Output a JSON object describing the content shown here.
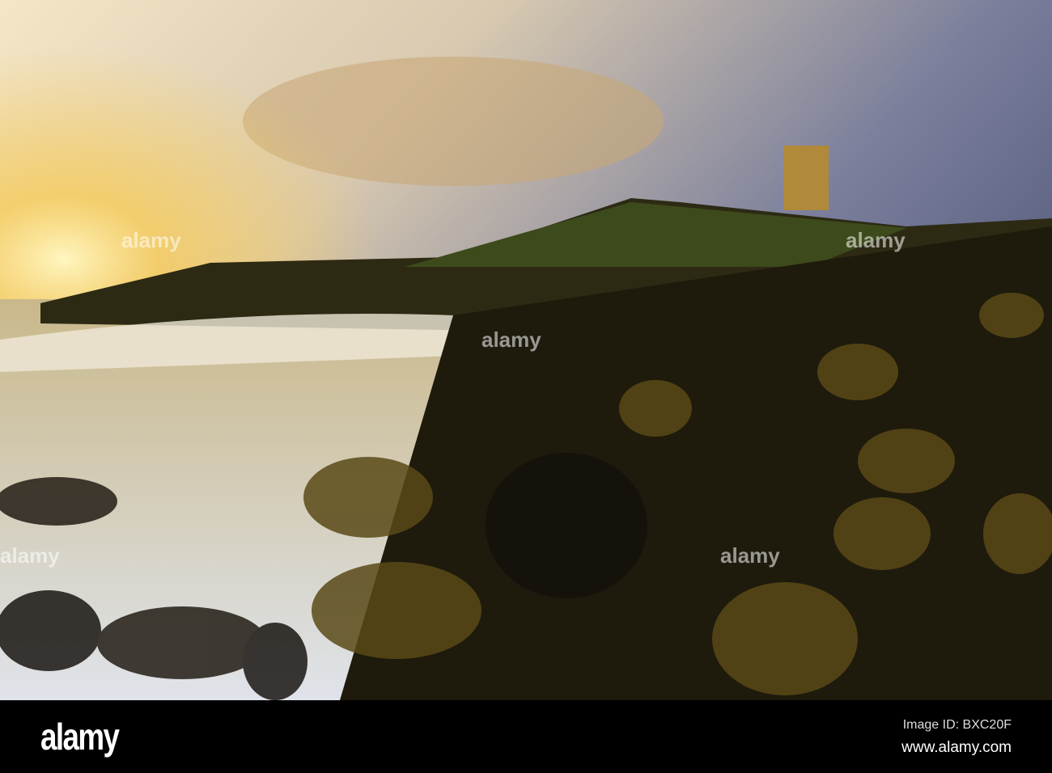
{
  "watermark": {
    "logo": "alamy"
  },
  "footer": {
    "logo": "alamy",
    "image_id": "Image ID: BXC20F",
    "site": "www.alamy.com"
  }
}
